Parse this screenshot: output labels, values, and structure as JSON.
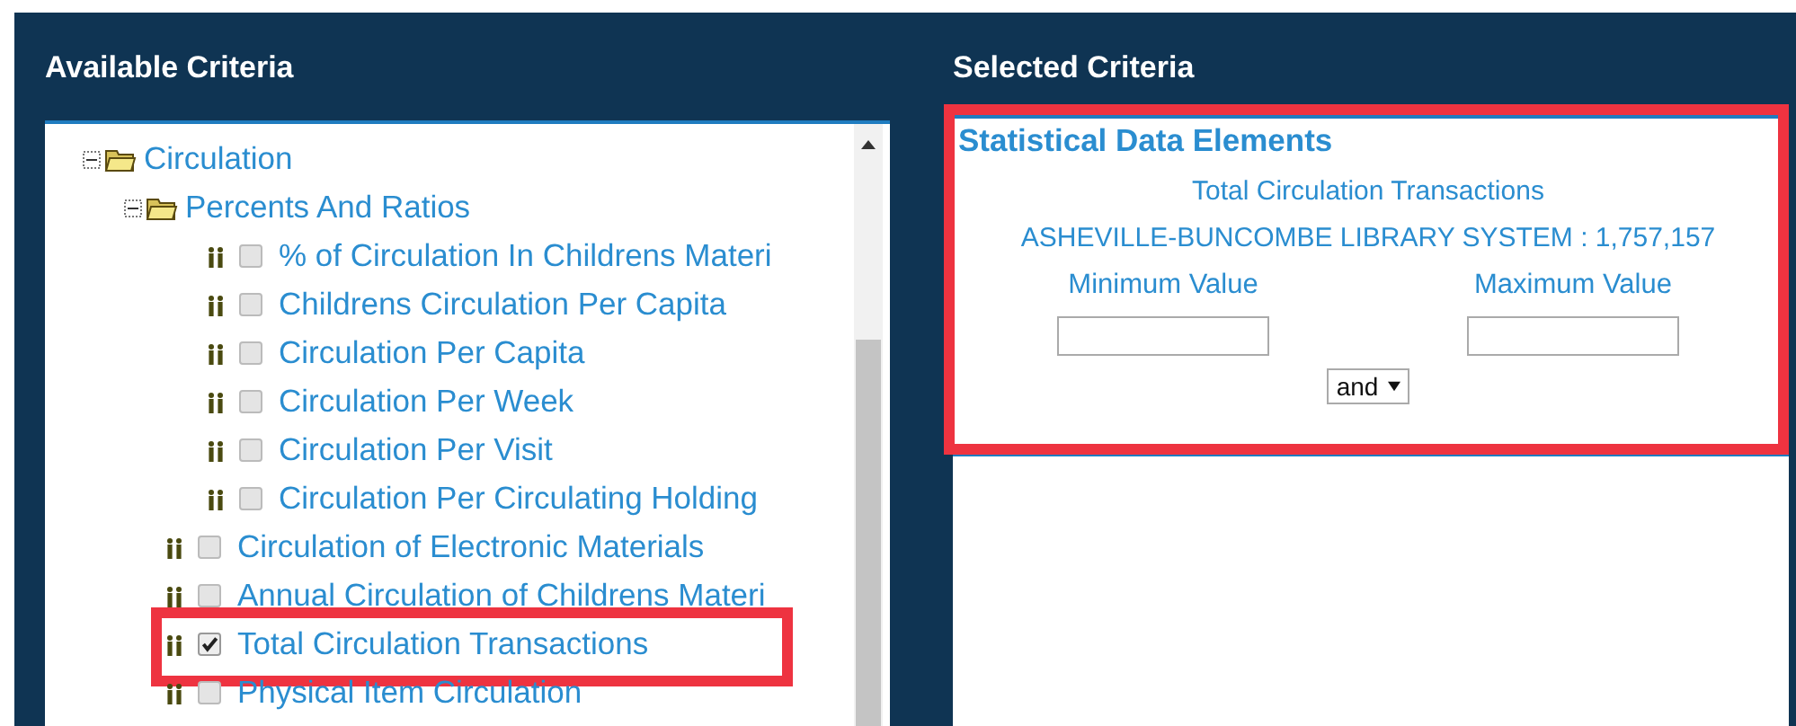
{
  "available_criteria": {
    "title": "Available Criteria",
    "tree": [
      {
        "kind": "folder",
        "label": "Circulation",
        "expanded": true,
        "children": [
          {
            "kind": "folder",
            "label": "Percents And Ratios",
            "expanded": true,
            "children": [
              {
                "kind": "item",
                "label": "% of Circulation In Childrens Materi",
                "checked": false,
                "highlighted": false
              },
              {
                "kind": "item",
                "label": "Childrens Circulation Per Capita",
                "checked": false,
                "highlighted": false
              },
              {
                "kind": "item",
                "label": "Circulation Per Capita",
                "checked": false,
                "highlighted": false
              },
              {
                "kind": "item",
                "label": "Circulation Per Week",
                "checked": false,
                "highlighted": false
              },
              {
                "kind": "item",
                "label": "Circulation Per Visit",
                "checked": false,
                "highlighted": false
              },
              {
                "kind": "item",
                "label": "Circulation Per Circulating Holding",
                "checked": false,
                "highlighted": false
              }
            ]
          },
          {
            "kind": "item",
            "label": "Circulation of Electronic Materials",
            "checked": false,
            "highlighted": false
          },
          {
            "kind": "item",
            "label": "Annual Circulation of Childrens Materi",
            "checked": false,
            "highlighted": false
          },
          {
            "kind": "item",
            "label": "Total Circulation Transactions",
            "checked": true,
            "highlighted": true
          },
          {
            "kind": "item",
            "label": "Physical Item Circulation",
            "checked": false,
            "highlighted": false
          }
        ]
      }
    ]
  },
  "selected_criteria": {
    "title": "Selected Criteria",
    "highlighted": true,
    "section_title": "Statistical Data Elements",
    "element_name": "Total Circulation Transactions",
    "library_value": "ASHEVILLE-BUNCOMBE LIBRARY SYSTEM : 1,757,157",
    "minimum_label": "Minimum Value",
    "maximum_label": "Maximum Value",
    "operator": "and"
  }
}
